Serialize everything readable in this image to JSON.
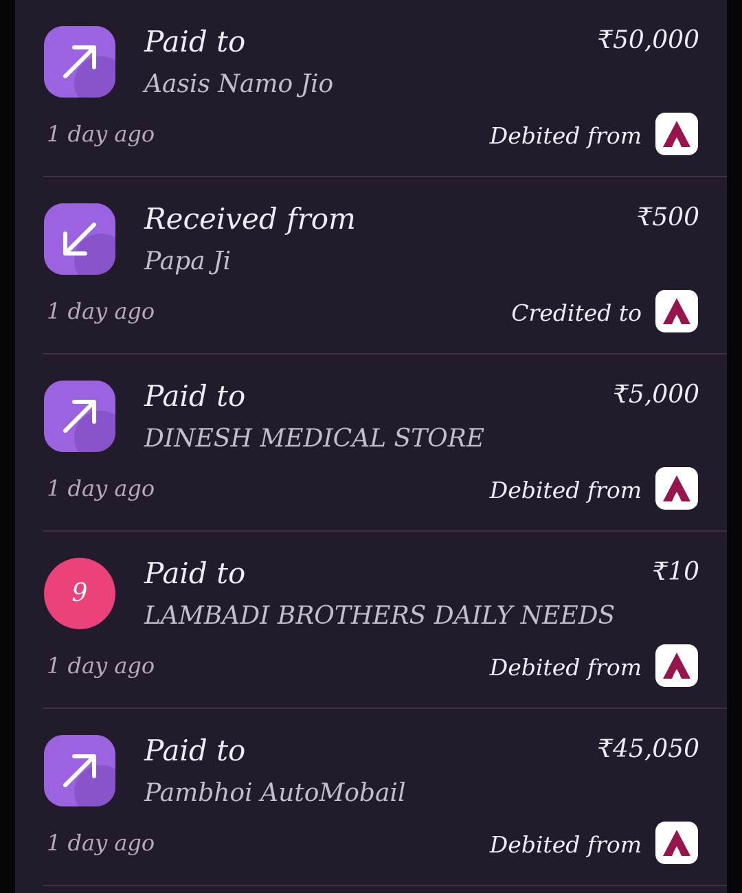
{
  "transactions": [
    {
      "title": "Paid to",
      "name": "Aasis Namo Jio",
      "amount": "₹50,000",
      "time": "1 day ago",
      "bank_label": "Debited from",
      "icon": "arrow-up-right-icon"
    },
    {
      "title": "Received from",
      "name": "Papa Ji",
      "amount": "₹500",
      "time": "1 day ago",
      "bank_label": "Credited to",
      "icon": "arrow-down-left-icon"
    },
    {
      "title": "Paid to",
      "name": "DINESH MEDICAL STORE",
      "amount": "₹5,000",
      "time": "1 day ago",
      "bank_label": "Debited from",
      "icon": "arrow-up-right-icon"
    },
    {
      "title": "Paid to",
      "name": "LAMBADI BROTHERS DAILY NEEDS",
      "amount": "₹10",
      "time": "1 day ago",
      "bank_label": "Debited from",
      "icon": "merchant-avatar",
      "avatar_text": "9"
    },
    {
      "title": "Paid to",
      "name": "Pambhoi AutoMobail",
      "amount": "₹45,050",
      "time": "1 day ago",
      "bank_label": "Debited from",
      "icon": "arrow-up-right-icon"
    }
  ],
  "colors": {
    "panel": "#221b2b",
    "avatar_purple": "#9b63e0",
    "avatar_pink": "#ea4279",
    "bank_logo": "#97144d"
  }
}
